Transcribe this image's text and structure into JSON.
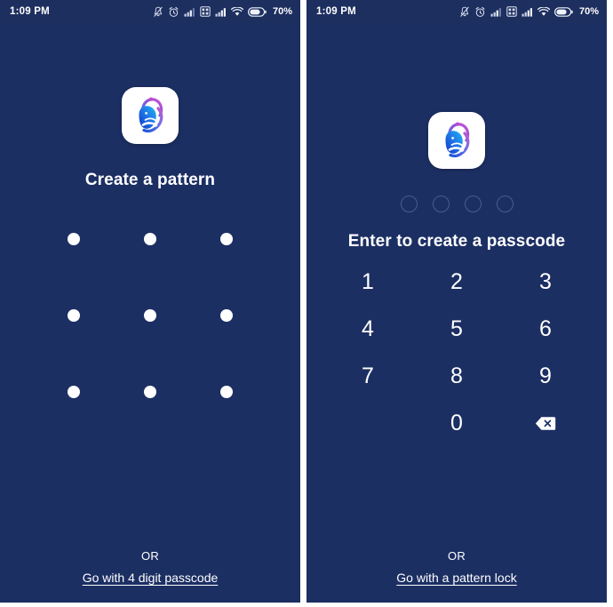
{
  "statusbar": {
    "time": "1:09 PM",
    "battery_percent": "70%",
    "icons": [
      "bell-muted-icon",
      "alarm-clock-icon",
      "signal-bars-icon",
      "sim-card-icon",
      "signal-bars-icon",
      "wifi-icon",
      "battery-icon"
    ]
  },
  "brand": {
    "logo_name": "app-logo",
    "logo_colors": {
      "blue": "#1558d6",
      "cyan": "#1aa3f0",
      "purple": "#a04ed9",
      "magenta": "#c34bc9",
      "background": "#ffffff"
    }
  },
  "theme": {
    "screen_background": "#1c2f63",
    "statusbar_background": "#1d2f5f",
    "text": "#ffffff",
    "dot_outline": "#4a5c92"
  },
  "pattern_screen": {
    "title": "Create a pattern",
    "grid_rows": 3,
    "grid_cols": 3,
    "dot_count": 9,
    "footer": {
      "or_label": "OR",
      "alt_link": "Go with 4 digit passcode"
    }
  },
  "passcode_screen": {
    "title": "Enter to create a passcode",
    "code_length": 4,
    "code_entered": 0,
    "keys": [
      {
        "label": "1",
        "name": "key-1"
      },
      {
        "label": "2",
        "name": "key-2"
      },
      {
        "label": "3",
        "name": "key-3"
      },
      {
        "label": "4",
        "name": "key-4"
      },
      {
        "label": "5",
        "name": "key-5"
      },
      {
        "label": "6",
        "name": "key-6"
      },
      {
        "label": "7",
        "name": "key-7"
      },
      {
        "label": "8",
        "name": "key-8"
      },
      {
        "label": "9",
        "name": "key-9"
      },
      {
        "label": "",
        "name": "key-blank"
      },
      {
        "label": "0",
        "name": "key-0"
      },
      {
        "label": "backspace-icon",
        "name": "key-backspace"
      }
    ],
    "footer": {
      "or_label": "OR",
      "alt_link": "Go with a pattern lock"
    }
  }
}
